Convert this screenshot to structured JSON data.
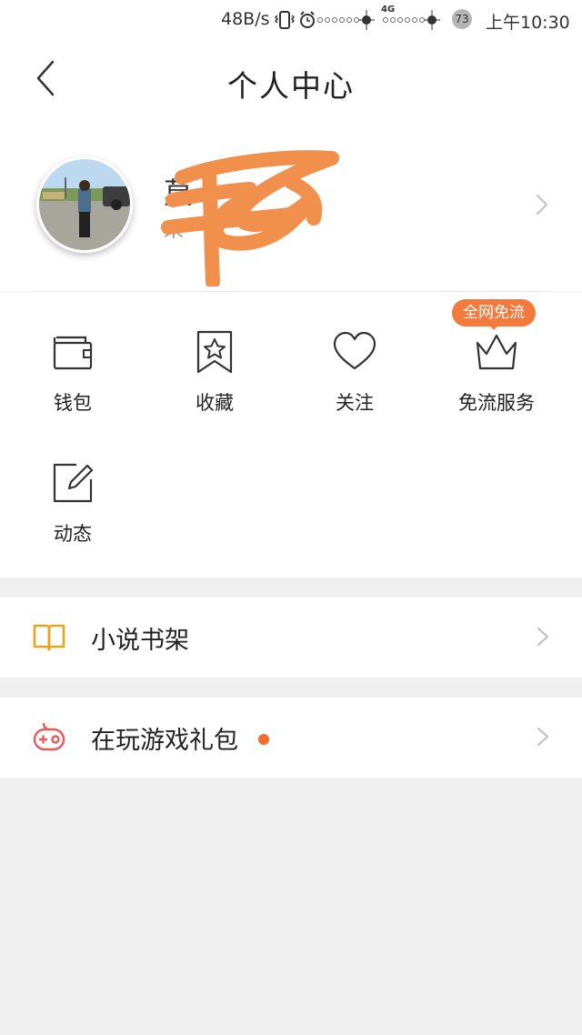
{
  "status_bar": {
    "speed": "48B/s",
    "network": "4G",
    "battery": "73",
    "time": "上午10:30"
  },
  "header": {
    "title": "个人中心",
    "back_icon": "chevron-left-icon"
  },
  "profile": {
    "name_visible": "莫",
    "sub_visible": "来",
    "avatar_icon": "user-photo"
  },
  "grid": {
    "items": [
      {
        "label": "钱包",
        "icon": "wallet-icon"
      },
      {
        "label": "收藏",
        "icon": "bookmark-star-icon"
      },
      {
        "label": "关注",
        "icon": "heart-icon"
      },
      {
        "label": "免流服务",
        "icon": "crown-icon",
        "badge": "全网免流"
      },
      {
        "label": "动态",
        "icon": "edit-icon"
      }
    ]
  },
  "rows": [
    {
      "label": "小说书架",
      "icon": "book-icon",
      "dot": false
    },
    {
      "label": "在玩游戏礼包",
      "icon": "gamepad-icon",
      "dot": true
    }
  ],
  "colors": {
    "accent": "#f27a3c",
    "book_icon": "#e8a51c",
    "game_icon": "#e85a5a",
    "background": "#efefef"
  }
}
